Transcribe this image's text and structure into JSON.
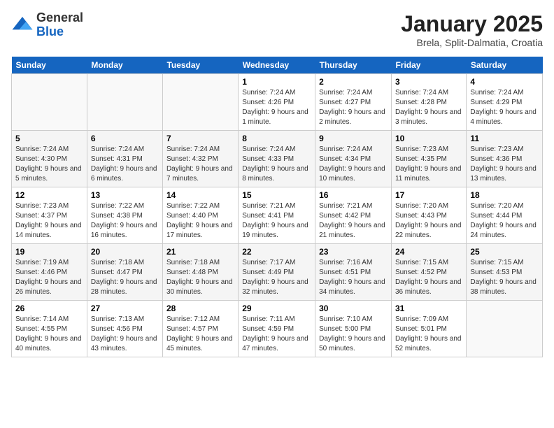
{
  "logo": {
    "general": "General",
    "blue": "Blue"
  },
  "title": "January 2025",
  "subtitle": "Brela, Split-Dalmatia, Croatia",
  "days_of_week": [
    "Sunday",
    "Monday",
    "Tuesday",
    "Wednesday",
    "Thursday",
    "Friday",
    "Saturday"
  ],
  "weeks": [
    [
      {
        "day": "",
        "info": ""
      },
      {
        "day": "",
        "info": ""
      },
      {
        "day": "",
        "info": ""
      },
      {
        "day": "1",
        "info": "Sunrise: 7:24 AM\nSunset: 4:26 PM\nDaylight: 9 hours and 1 minute."
      },
      {
        "day": "2",
        "info": "Sunrise: 7:24 AM\nSunset: 4:27 PM\nDaylight: 9 hours and 2 minutes."
      },
      {
        "day": "3",
        "info": "Sunrise: 7:24 AM\nSunset: 4:28 PM\nDaylight: 9 hours and 3 minutes."
      },
      {
        "day": "4",
        "info": "Sunrise: 7:24 AM\nSunset: 4:29 PM\nDaylight: 9 hours and 4 minutes."
      }
    ],
    [
      {
        "day": "5",
        "info": "Sunrise: 7:24 AM\nSunset: 4:30 PM\nDaylight: 9 hours and 5 minutes."
      },
      {
        "day": "6",
        "info": "Sunrise: 7:24 AM\nSunset: 4:31 PM\nDaylight: 9 hours and 6 minutes."
      },
      {
        "day": "7",
        "info": "Sunrise: 7:24 AM\nSunset: 4:32 PM\nDaylight: 9 hours and 7 minutes."
      },
      {
        "day": "8",
        "info": "Sunrise: 7:24 AM\nSunset: 4:33 PM\nDaylight: 9 hours and 8 minutes."
      },
      {
        "day": "9",
        "info": "Sunrise: 7:24 AM\nSunset: 4:34 PM\nDaylight: 9 hours and 10 minutes."
      },
      {
        "day": "10",
        "info": "Sunrise: 7:23 AM\nSunset: 4:35 PM\nDaylight: 9 hours and 11 minutes."
      },
      {
        "day": "11",
        "info": "Sunrise: 7:23 AM\nSunset: 4:36 PM\nDaylight: 9 hours and 13 minutes."
      }
    ],
    [
      {
        "day": "12",
        "info": "Sunrise: 7:23 AM\nSunset: 4:37 PM\nDaylight: 9 hours and 14 minutes."
      },
      {
        "day": "13",
        "info": "Sunrise: 7:22 AM\nSunset: 4:38 PM\nDaylight: 9 hours and 16 minutes."
      },
      {
        "day": "14",
        "info": "Sunrise: 7:22 AM\nSunset: 4:40 PM\nDaylight: 9 hours and 17 minutes."
      },
      {
        "day": "15",
        "info": "Sunrise: 7:21 AM\nSunset: 4:41 PM\nDaylight: 9 hours and 19 minutes."
      },
      {
        "day": "16",
        "info": "Sunrise: 7:21 AM\nSunset: 4:42 PM\nDaylight: 9 hours and 21 minutes."
      },
      {
        "day": "17",
        "info": "Sunrise: 7:20 AM\nSunset: 4:43 PM\nDaylight: 9 hours and 22 minutes."
      },
      {
        "day": "18",
        "info": "Sunrise: 7:20 AM\nSunset: 4:44 PM\nDaylight: 9 hours and 24 minutes."
      }
    ],
    [
      {
        "day": "19",
        "info": "Sunrise: 7:19 AM\nSunset: 4:46 PM\nDaylight: 9 hours and 26 minutes."
      },
      {
        "day": "20",
        "info": "Sunrise: 7:18 AM\nSunset: 4:47 PM\nDaylight: 9 hours and 28 minutes."
      },
      {
        "day": "21",
        "info": "Sunrise: 7:18 AM\nSunset: 4:48 PM\nDaylight: 9 hours and 30 minutes."
      },
      {
        "day": "22",
        "info": "Sunrise: 7:17 AM\nSunset: 4:49 PM\nDaylight: 9 hours and 32 minutes."
      },
      {
        "day": "23",
        "info": "Sunrise: 7:16 AM\nSunset: 4:51 PM\nDaylight: 9 hours and 34 minutes."
      },
      {
        "day": "24",
        "info": "Sunrise: 7:15 AM\nSunset: 4:52 PM\nDaylight: 9 hours and 36 minutes."
      },
      {
        "day": "25",
        "info": "Sunrise: 7:15 AM\nSunset: 4:53 PM\nDaylight: 9 hours and 38 minutes."
      }
    ],
    [
      {
        "day": "26",
        "info": "Sunrise: 7:14 AM\nSunset: 4:55 PM\nDaylight: 9 hours and 40 minutes."
      },
      {
        "day": "27",
        "info": "Sunrise: 7:13 AM\nSunset: 4:56 PM\nDaylight: 9 hours and 43 minutes."
      },
      {
        "day": "28",
        "info": "Sunrise: 7:12 AM\nSunset: 4:57 PM\nDaylight: 9 hours and 45 minutes."
      },
      {
        "day": "29",
        "info": "Sunrise: 7:11 AM\nSunset: 4:59 PM\nDaylight: 9 hours and 47 minutes."
      },
      {
        "day": "30",
        "info": "Sunrise: 7:10 AM\nSunset: 5:00 PM\nDaylight: 9 hours and 50 minutes."
      },
      {
        "day": "31",
        "info": "Sunrise: 7:09 AM\nSunset: 5:01 PM\nDaylight: 9 hours and 52 minutes."
      },
      {
        "day": "",
        "info": ""
      }
    ]
  ]
}
